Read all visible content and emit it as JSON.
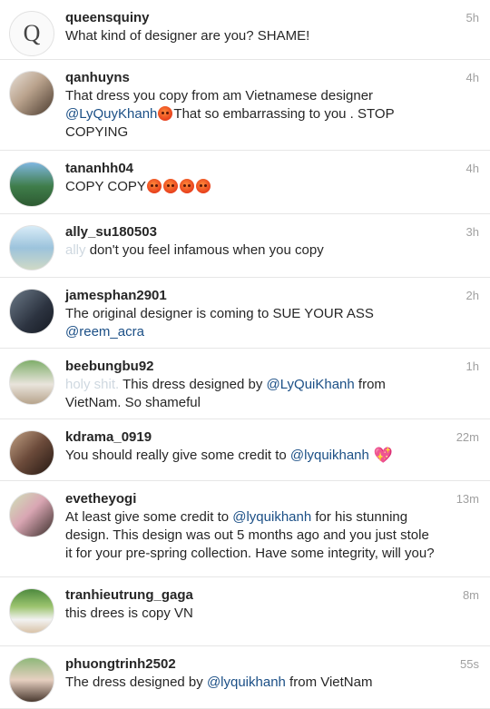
{
  "comments": [
    {
      "user": "queensquiny",
      "time": "5h",
      "avatar_letter": "Q",
      "avatar": "#fafafa",
      "parts": [
        {
          "t": "What kind of designer are you? SHAME!"
        }
      ]
    },
    {
      "user": "qanhuyns",
      "time": "4h",
      "avatar": "linear-gradient(135deg,#e8e0d8 0%,#b9a28c 45%,#4a3a2e 100%)",
      "parts": [
        {
          "t": "That dress you copy from am Vietnamese designer "
        },
        {
          "m": "@LyQuyKhanh"
        },
        {
          "e": "angry-face-emoji"
        },
        {
          "t": "That so embarrassing to you . STOP COPYING"
        }
      ]
    },
    {
      "user": "tananhh04",
      "time": "4h",
      "avatar": "linear-gradient(180deg,#7fb6e0 0%,#3f7d4a 55%,#2d5a32 100%)",
      "parts": [
        {
          "t": "COPY  COPY"
        },
        {
          "e": "angry-face-emoji"
        },
        {
          "e": "angry-face-emoji"
        },
        {
          "e": "angry-face-emoji"
        },
        {
          "e": "angry-face-emoji"
        }
      ]
    },
    {
      "user": "ally_su180503",
      "time": "3h",
      "avatar": "linear-gradient(180deg,#d8ecf7 0%,#9cc3dc 50%,#cfd9c6 100%)",
      "parts": [
        {
          "f": "ally "
        },
        {
          "t": "don't you feel infamous when you copy"
        }
      ]
    },
    {
      "user": "jamesphan2901",
      "time": "2h",
      "avatar": "linear-gradient(135deg,#6c7a88 0%,#2c3340 60%,#151a22 100%)",
      "parts": [
        {
          "t": "The original designer is coming to SUE YOUR ASS "
        },
        {
          "m": "@reem_acra"
        }
      ]
    },
    {
      "user": "beebungbu92",
      "time": "1h",
      "avatar": "linear-gradient(180deg,#7fae6a 0%,#e9e4dc 55%,#b7a48c 100%)",
      "parts": [
        {
          "f": "holy shit. "
        },
        {
          "t": "This dress designed by "
        },
        {
          "m": "@LyQuiKhanh"
        },
        {
          "t": " from VietNam. So shameful"
        }
      ]
    },
    {
      "user": "kdrama_0919",
      "time": "22m",
      "avatar": "linear-gradient(135deg,#c2a285 0%,#6b4a3a 50%,#241812 100%)",
      "parts": [
        {
          "t": "You should really give some credit to "
        },
        {
          "m": "@lyquikhanh"
        },
        {
          "h": "💖"
        }
      ]
    },
    {
      "user": "evetheyogi",
      "time": "13m",
      "avatar": "linear-gradient(135deg,#cfe3b8 0%,#d9a6b3 45%,#3a2e2a 100%)",
      "parts": [
        {
          "t": "At least give some credit to "
        },
        {
          "m": "@lyquikhanh"
        },
        {
          "t": " for his stunning design. This design was out 5 months ago and you just stole it for your pre-spring collection. Have some integrity, will you?"
        }
      ]
    },
    {
      "user": "tranhieutrung_gaga",
      "time": "8m",
      "avatar": "linear-gradient(180deg,#4d8a3e 0%,#9cc46f 40%,#f2f2f2 70%,#d9c3a8 100%)",
      "parts": [
        {
          "t": "this drees is copy VN"
        }
      ]
    },
    {
      "user": "phuongtrinh2502",
      "time": "55s",
      "avatar": "linear-gradient(180deg,#8fb87a 0%,#e6cfc0 50%,#4a3a30 100%)",
      "parts": [
        {
          "t": "The dress designed by "
        },
        {
          "m": "@lyquikhanh"
        },
        {
          "t": "  from VietNam"
        }
      ]
    }
  ]
}
